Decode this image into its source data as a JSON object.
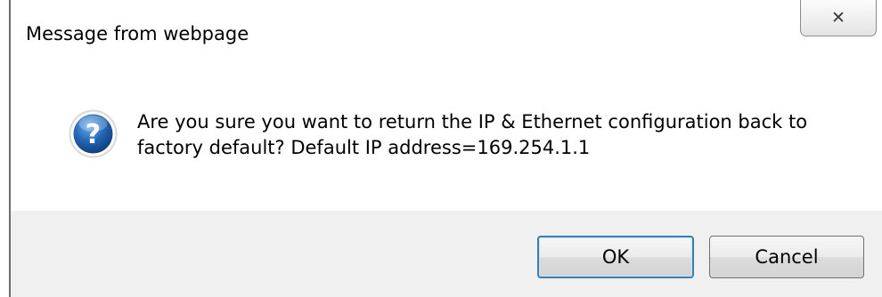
{
  "window": {
    "title": "Message from webpage",
    "close_glyph": "✕"
  },
  "message": {
    "line1": "Are you sure you want to return the IP & Ethernet configuration back to",
    "line2": "factory default? Default IP address=169.254.1.1",
    "icon": "question-icon"
  },
  "buttons": {
    "ok_label": "OK",
    "cancel_label": "Cancel"
  },
  "colors": {
    "icon_blue": "#1d5fa8",
    "footer_bg": "#f0f0f0",
    "default_button_border": "#3c7fb1"
  }
}
